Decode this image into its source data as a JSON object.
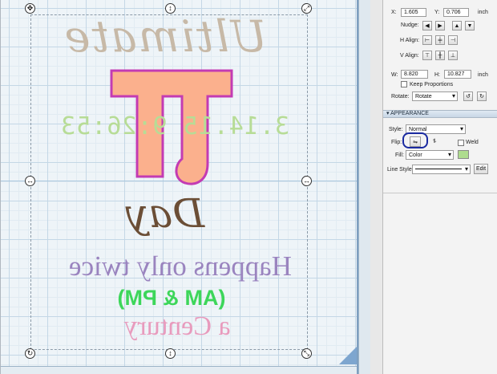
{
  "canvas": {
    "texts": {
      "ultimate": "Ultimate",
      "pi": "π",
      "time": "3.14.15 9:26:53",
      "day": "Day",
      "happens": "Happens only twice",
      "ampm": "(AM & PM)",
      "century": "a Century"
    },
    "colors": {
      "ultimate": "#c7b9a7",
      "pi_fill": "#fbb08d",
      "pi_stroke": "#c33bb3",
      "time": "#b7dc96",
      "day": "#6b4e36",
      "happens": "#9a84bf",
      "ampm": "#3dd65a",
      "century": "#e89bbd"
    },
    "handles": [
      "rotate-handle",
      "resize-handle",
      "move-handle"
    ]
  },
  "panel": {
    "position": {
      "x_label": "X:",
      "x_value": "1.605",
      "y_label": "Y:",
      "y_value": "0.706",
      "unit": "inch"
    },
    "nudge_label": "Nudge:",
    "h_align_label": "H Align:",
    "v_align_label": "V Align:",
    "size": {
      "w_label": "W:",
      "w_value": "8.820",
      "h_label": "H:",
      "h_value": "10.827",
      "unit": "inch"
    },
    "keep_proportions": "Keep Proportions",
    "rotate_label": "Rotate:",
    "rotate_value": "Rotate",
    "appearance": {
      "header": "APPEARANCE",
      "style_label": "Style:",
      "style_value": "Normal",
      "flip_label": "Flip:",
      "weld_label": "Weld",
      "fill_label": "Fill:",
      "fill_value": "Color",
      "fill_color": "#aedc8e",
      "line_style_label": "Line Style:",
      "edit_button": "Edit"
    }
  }
}
